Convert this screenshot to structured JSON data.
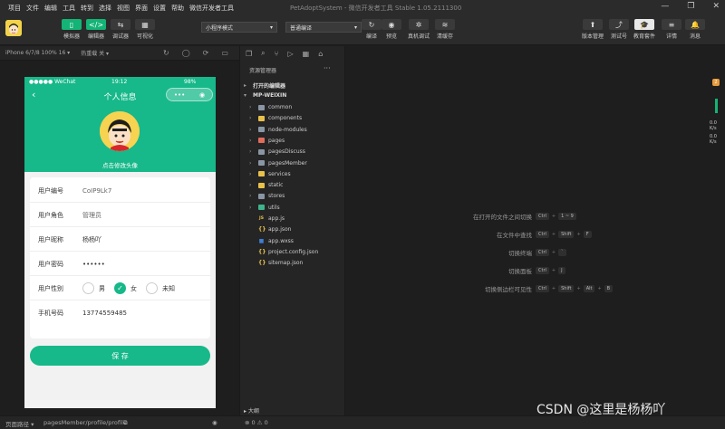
{
  "menu": [
    "项目",
    "文件",
    "编辑",
    "工具",
    "转到",
    "选择",
    "视图",
    "界面",
    "设置",
    "帮助",
    "微信开发者工具"
  ],
  "window_title": "PetAdoptSystem - 微信开发者工具 Stable 1.05.2111300",
  "toolbar": {
    "left_buttons": [
      {
        "label": "模拟器",
        "icon": "phone-icon"
      },
      {
        "label": "编辑器",
        "icon": "code-icon"
      },
      {
        "label": "调试器",
        "icon": "debug-icon"
      },
      {
        "label": "可视化",
        "icon": "grid-icon"
      }
    ],
    "mode_select": "小程序模式",
    "compile_select": "普通编译",
    "mid_buttons": [
      {
        "label": "编译",
        "icon": "refresh-icon"
      },
      {
        "label": "预览",
        "icon": "eye-icon"
      },
      {
        "label": "真机调试",
        "icon": "bug-icon"
      },
      {
        "label": "清缓存",
        "icon": "layers-icon"
      }
    ],
    "right_buttons": [
      {
        "label": "版本管理",
        "icon": "upload-icon"
      },
      {
        "label": "测试号",
        "icon": "chart-icon"
      },
      {
        "label": "教育套件",
        "icon": "cap-icon"
      },
      {
        "label": "详情",
        "icon": "menu-icon"
      },
      {
        "label": "消息",
        "icon": "bell-icon"
      }
    ]
  },
  "subbar": {
    "device": "iPhone 6/7/8 100% 16 ▾",
    "hotreload": "热重载 关 ▾"
  },
  "phone": {
    "carrier": "●●●●● WeChat",
    "time": "19:12",
    "battery": "98%",
    "title": "个人信息",
    "change_avatar": "点击修改头像",
    "fields": [
      {
        "label": "用户编号",
        "value": "CoIP9Lk7"
      },
      {
        "label": "用户角色",
        "value": "管理员"
      },
      {
        "label": "用户昵称",
        "value": "杨杨吖"
      },
      {
        "label": "用户密码",
        "value": "••••••"
      },
      {
        "label": "用户性别",
        "value": ""
      },
      {
        "label": "手机号码",
        "value": "13774559485"
      }
    ],
    "gender_options": [
      "男",
      "女",
      "未知"
    ],
    "gender_selected": "女",
    "save_label": "保 存"
  },
  "explorer": {
    "title": "资源管理器",
    "open_editors": "打开的编辑器",
    "project": "MP-WEIXIN",
    "items": [
      {
        "name": "common",
        "type": "folder",
        "color": "gray"
      },
      {
        "name": "components",
        "type": "folder",
        "color": "yellow"
      },
      {
        "name": "node-modules",
        "type": "folder",
        "color": "gray"
      },
      {
        "name": "pages",
        "type": "folder",
        "color": "red"
      },
      {
        "name": "pagesDiscuss",
        "type": "folder",
        "color": "gray"
      },
      {
        "name": "pagesMember",
        "type": "folder",
        "color": "gray"
      },
      {
        "name": "services",
        "type": "folder",
        "color": "yellow"
      },
      {
        "name": "static",
        "type": "folder",
        "color": "yellow"
      },
      {
        "name": "stores",
        "type": "folder",
        "color": "gray"
      },
      {
        "name": "utils",
        "type": "folder",
        "color": "teal"
      },
      {
        "name": "app.js",
        "type": "js"
      },
      {
        "name": "app.json",
        "type": "json"
      },
      {
        "name": "app.wxss",
        "type": "wxss"
      },
      {
        "name": "project.config.json",
        "type": "json"
      },
      {
        "name": "sitemap.json",
        "type": "json"
      }
    ],
    "outline": "大纲"
  },
  "shortcuts": [
    {
      "desc": "在打开的文件之间切换",
      "keys": [
        "Ctrl",
        "1 ~ 9"
      ]
    },
    {
      "desc": "在文件中查找",
      "keys": [
        "Ctrl",
        "Shift",
        "F"
      ]
    },
    {
      "desc": "切换终端",
      "keys": [
        "Ctrl",
        "`"
      ]
    },
    {
      "desc": "切换面板",
      "keys": [
        "Ctrl",
        "J"
      ]
    },
    {
      "desc": "切换侧边栏可见性",
      "keys": [
        "Ctrl",
        "Shift",
        "Alt",
        "B"
      ]
    }
  ],
  "meter": {
    "badge": "2",
    "val1": "0.0",
    "unit1": "K/s",
    "val2": "0.0",
    "unit2": "K/s"
  },
  "statusbar": {
    "path_label": "页面路径 ▾",
    "path": "pagesMember/profile/profile",
    "errors": "⊗ 0 ⚠ 0"
  },
  "watermark": "CSDN @这里是杨杨吖",
  "colors": {
    "accent": "#17b88a",
    "toolbar_green": "#14b376"
  }
}
